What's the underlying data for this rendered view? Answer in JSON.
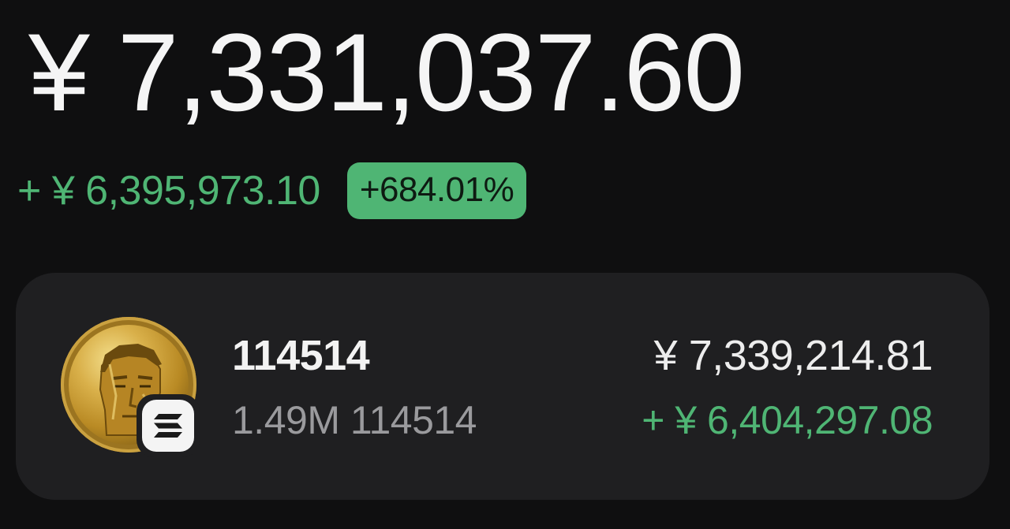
{
  "portfolio": {
    "total_balance": "¥ 7,331,037.60",
    "change_amount": "+ ¥ 6,395,973.10",
    "change_percent": "+684.01%"
  },
  "token": {
    "name": "114514",
    "holdings": "1.49M 114514",
    "value": "¥ 7,339,214.81",
    "change": "+ ¥ 6,404,297.08",
    "avatar_icon": "gold-coin-portrait-icon",
    "chain_icon": "solana-icon"
  },
  "colors": {
    "background": "#0f0f10",
    "card": "#1f1f21",
    "positive": "#4fb574",
    "muted_text": "#9a9a9d"
  }
}
